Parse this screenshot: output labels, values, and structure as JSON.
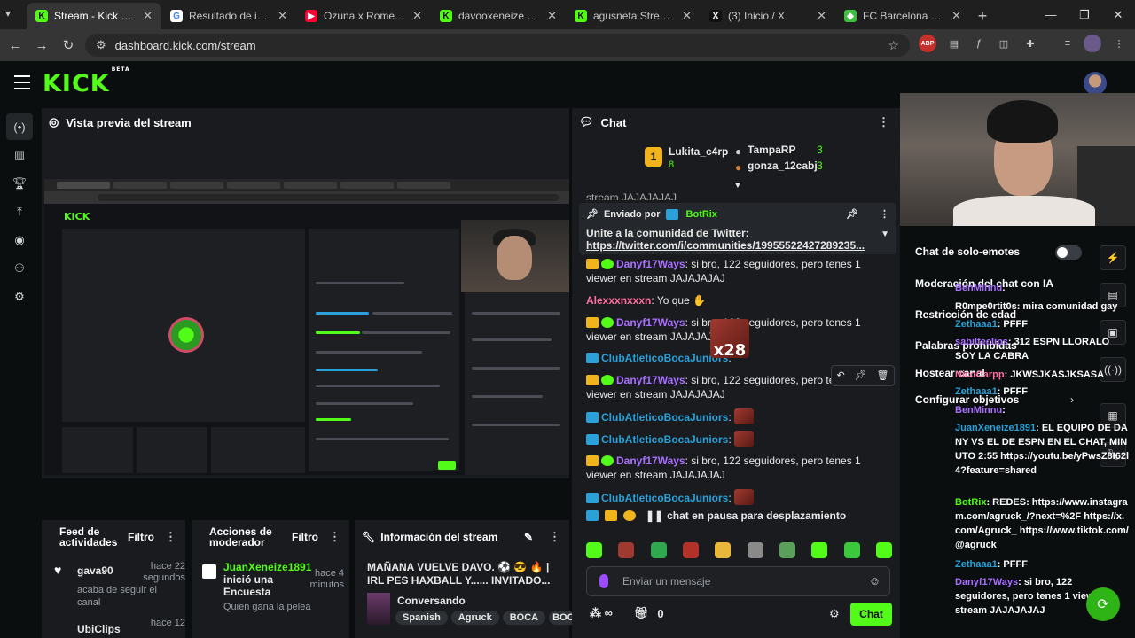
{
  "browser": {
    "tabs": [
      {
        "title": "Stream - Kick Dashbo...",
        "color": "#53fc18",
        "glyph": "K"
      },
      {
        "title": "Resultado de imágenes",
        "color": "#ffffff",
        "glyph": "G"
      },
      {
        "title": "Ozuna x Romeo Santo",
        "color": "#ff0033",
        "glyph": "▶"
      },
      {
        "title": "davooxeneize Stream",
        "color": "#53fc18",
        "glyph": "K"
      },
      {
        "title": "agusneta Stream - Wa",
        "color": "#53fc18",
        "glyph": "K"
      },
      {
        "title": "(3) Inicio / X",
        "color": "#ffffff",
        "glyph": "X"
      },
      {
        "title": "FC Barcelona Vs Athle",
        "color": "#3fbf3f",
        "glyph": "⚽"
      }
    ],
    "url": "dashboard.kick.com/stream"
  },
  "kick": {
    "logo": "KICK",
    "logo_badge": "BETA"
  },
  "preview": {
    "title": "Vista previa del stream"
  },
  "feed": {
    "title": "Feed de actividades",
    "filter": "Filtro",
    "items": [
      {
        "user": "gava90",
        "time": "hace 22 segundos",
        "text": "acaba de seguir el canal"
      },
      {
        "user": "UbiClips",
        "time": "hace 12"
      }
    ]
  },
  "mods": {
    "title": "Acciones de moderador",
    "filter": "Filtro",
    "item": {
      "user": "JuanXeneize1891",
      "text": "inició una Encuesta",
      "time": "hace 4 minutos",
      "sub": "Quien gana la pelea"
    }
  },
  "info": {
    "title": "Información del stream",
    "stream_title": "MAÑANA VUELVE DAVO. ⚽ 😎 🔥 | IRL PES HAXBALL Y...... INVITADO...",
    "category": "Conversando",
    "tags": [
      "Spanish",
      "Agruck",
      "BOCA",
      "BOC"
    ]
  },
  "chat": {
    "title": "Chat",
    "podium": [
      {
        "rank": "1",
        "user": "Lukita_c4rp",
        "count": "8"
      },
      {
        "user": "TampaRP",
        "count": "3"
      },
      {
        "user": "gonza_12cabj",
        "count": "3"
      }
    ],
    "pinned": {
      "sent_by": "Enviado por",
      "bot": "BotRix",
      "text": "Unite a la comunidad de Twitter:",
      "link": "https://twitter.com/i/communities/19955522427289235..."
    },
    "cut_line": "stream JAJAJAJAJ",
    "messages": [
      {
        "user": "Danyf17Ways",
        "kind": "green",
        "text": ": si bro, 122 seguidores, pero tenes 1 viewer en stream JAJAJAJAJ"
      },
      {
        "user": "Alexxxnxxxn",
        "kind": "pink",
        "text": ": Yo que"
      },
      {
        "user": "Danyf17Ways",
        "kind": "green",
        "text": ": si bro, 122 seguidores, pero tenes 1 viewer en stream JAJAJAJAJ"
      },
      {
        "user": "ClubAtleticoBocaJuniors",
        "kind": "blue",
        "text": ":"
      },
      {
        "user": "Danyf17Ways",
        "kind": "green",
        "text": ": si bro, 122 seguidores, pero tenes 1 viewer en stream JAJAJAJAJ"
      },
      {
        "user": "ClubAtleticoBocaJuniors",
        "kind": "blue",
        "text": ":"
      },
      {
        "user": "ClubAtleticoBocaJuniors",
        "kind": "blue",
        "text": ":"
      },
      {
        "user": "Danyf17Ways",
        "kind": "green",
        "text": ": si bro, 122 seguidores, pero tenes 1 viewer en stream JAJAJAJAJ"
      },
      {
        "user": "ClubAtleticoBocaJuniors",
        "kind": "blue",
        "text": ":"
      }
    ],
    "x28": "x28",
    "paused": "chat en pausa para desplazamiento",
    "input_placeholder": "Enviar un mensaje",
    "viewer_count": "0",
    "send": "Chat"
  },
  "settings": {
    "emote_only": "Chat de solo-emotes",
    "ai_mod": "Moderación del chat con IA",
    "restrict_age": "Restricción de edad",
    "banned_words": "Palabras prohibidas",
    "host": "Hostear canal",
    "objectives": "Configurar objetivos"
  },
  "right_chat": [
    {
      "user": "BenMinnu",
      "text": ":"
    },
    {
      "user": "R0mpe0rtit0s",
      "text": ": mira comunidad gay"
    },
    {
      "user": "Zethaaa1",
      "text": ": PFFF"
    },
    {
      "user": "sabilteclips",
      "text": ": 312 ESPN LLORALO SOY LA CABRA"
    },
    {
      "user": "NicoCarpp",
      "text": ": JKWSJKASJKSASA"
    },
    {
      "user": "Zethaaa1",
      "text": ": PFFF"
    },
    {
      "user": "BenMinnu",
      "text": ":"
    },
    {
      "user": "JuanXeneize1891",
      "text": ": EL EQUIPO DE DANY VS EL DE ESPN EN EL CHAT, MINUTO 2:55 https://youtu.be/yPwsZ8I62l4?feature=shared"
    },
    {
      "user": "BotRix",
      "text": ": REDES: https://www.instagram.com/agruck_/?next=%2F https://x.com/Agruck_ https://www.tiktok.com/@agruck"
    },
    {
      "user": "Zethaaa1",
      "text": ": PFFF"
    },
    {
      "user": "Danyf17Ways",
      "text": ": si bro, 122 seguidores, pero tenes 1 viewer en stream JAJAJAJAJ"
    }
  ]
}
